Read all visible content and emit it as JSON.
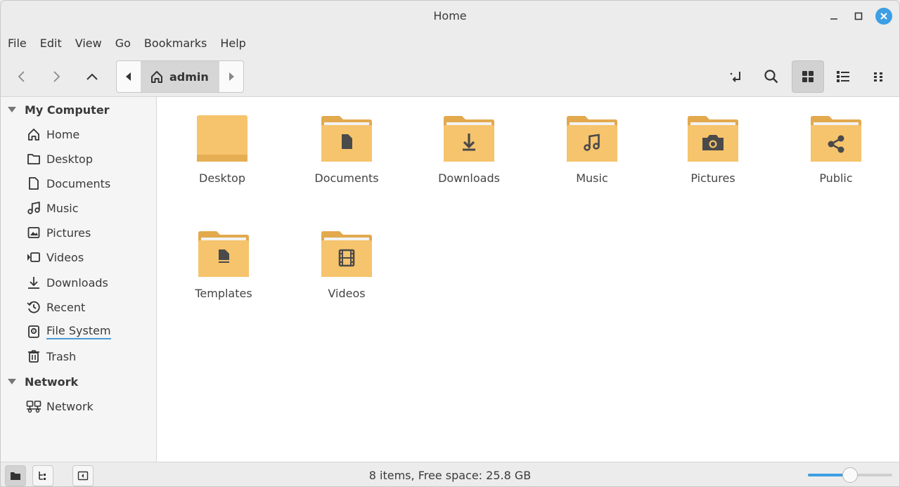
{
  "window": {
    "title": "Home"
  },
  "menu": [
    "File",
    "Edit",
    "View",
    "Go",
    "Bookmarks",
    "Help"
  ],
  "pathbar": {
    "current": "admin"
  },
  "sidebar": {
    "sections": [
      {
        "title": "My Computer"
      },
      {
        "title": "Network"
      }
    ],
    "computer_items": [
      {
        "label": "Home",
        "icon": "home-icon"
      },
      {
        "label": "Desktop",
        "icon": "folder-icon"
      },
      {
        "label": "Documents",
        "icon": "document-icon"
      },
      {
        "label": "Music",
        "icon": "music-icon"
      },
      {
        "label": "Pictures",
        "icon": "pictures-icon"
      },
      {
        "label": "Videos",
        "icon": "video-icon"
      },
      {
        "label": "Downloads",
        "icon": "download-icon"
      },
      {
        "label": "Recent",
        "icon": "recent-icon"
      },
      {
        "label": "File System",
        "icon": "drive-icon"
      },
      {
        "label": "Trash",
        "icon": "trash-icon"
      }
    ],
    "network_items": [
      {
        "label": "Network",
        "icon": "network-icon"
      }
    ]
  },
  "files": [
    {
      "name": "Desktop",
      "emblem": "none"
    },
    {
      "name": "Documents",
      "emblem": "document"
    },
    {
      "name": "Downloads",
      "emblem": "download"
    },
    {
      "name": "Music",
      "emblem": "music"
    },
    {
      "name": "Pictures",
      "emblem": "camera"
    },
    {
      "name": "Public",
      "emblem": "share"
    },
    {
      "name": "Templates",
      "emblem": "template"
    },
    {
      "name": "Videos",
      "emblem": "film"
    }
  ],
  "status": {
    "text": "8 items, Free space: 25.8 GB",
    "zoom_fraction": 0.5
  },
  "colors": {
    "accent": "#3d9ee4",
    "folder": "#f6c46c",
    "folder_dark": "#e3a94d",
    "emblem": "#4a4a4a"
  }
}
